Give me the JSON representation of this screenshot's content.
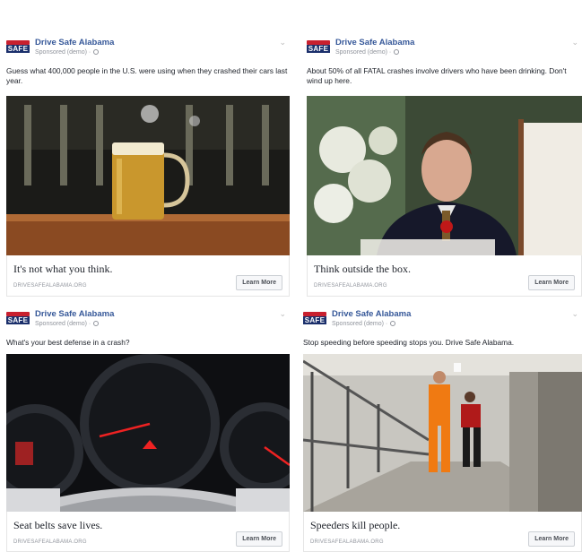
{
  "ads": [
    {
      "page_name": "Drive Safe Alabama",
      "sponsored": "Sponsored (demo) ·",
      "logo_text": "SAFE",
      "body": "Guess what 400,000 people in the U.S. were using when they crashed their cars last year.",
      "image": "beer-mug",
      "headline": "It's not what you think.",
      "domain": "DRIVESAFEALABAMA.ORG",
      "cta": "Learn More"
    },
    {
      "page_name": "Drive Safe Alabama",
      "sponsored": "Sponsored (demo) ·",
      "logo_text": "SAFE",
      "body": "About 50% of all FATAL crashes involve drivers who have been drinking. Don't wind up here.",
      "image": "funeral-man",
      "headline": "Think outside the box.",
      "domain": "DRIVESAFEALABAMA.ORG",
      "cta": "Learn More"
    },
    {
      "page_name": "Drive Safe Alabama",
      "sponsored": "Sponsored (demo) ·",
      "logo_text": "SAFE",
      "body": "What's your best defense in a crash?",
      "image": "dashboard",
      "headline": "Seat belts save lives.",
      "domain": "DRIVESAFEALABAMA.ORG",
      "cta": "Learn More"
    },
    {
      "page_name": "Drive Safe Alabama",
      "sponsored": "Sponsored (demo) ·",
      "logo_text": "SAFE",
      "body": "Stop speeding before speeding stops you. Drive Safe Alabama.",
      "image": "prison-hallway",
      "headline": "Speeders kill people.",
      "domain": "DRIVESAFEALABAMA.ORG",
      "cta": "Learn More"
    }
  ]
}
